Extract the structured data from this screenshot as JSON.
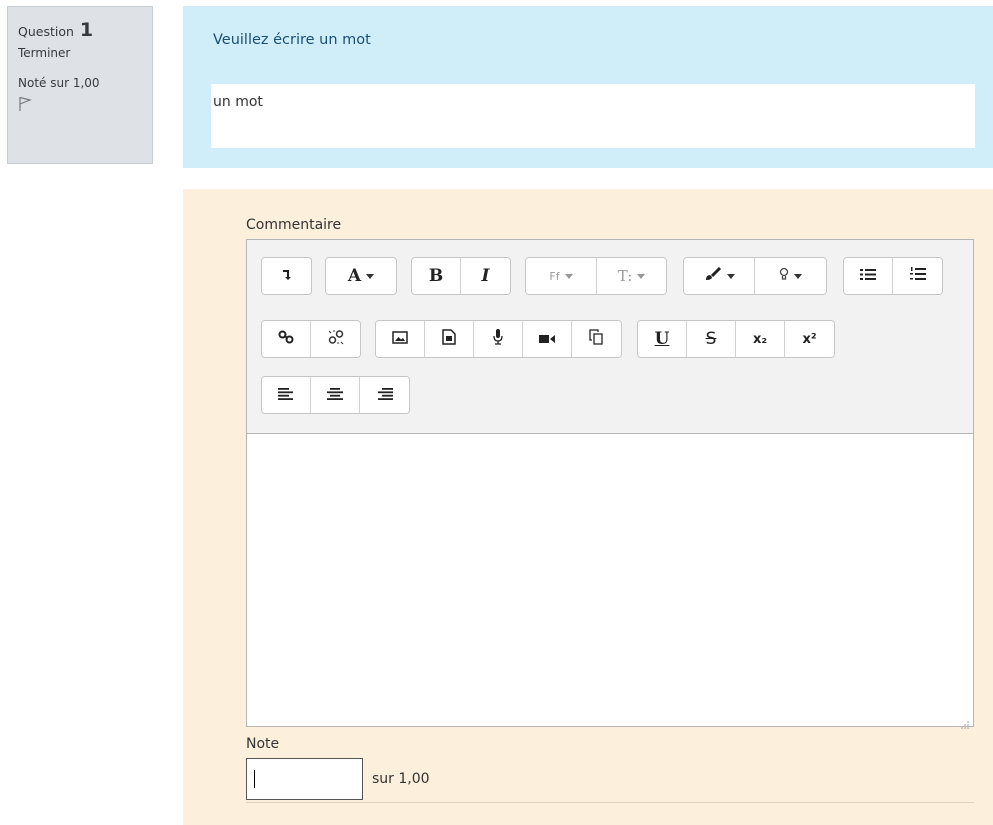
{
  "info": {
    "question_word": "Question",
    "question_number": "1",
    "state": "Terminer",
    "grade": "Noté sur 1,00",
    "flag_icon": "flag-icon"
  },
  "question": {
    "text": "Veuillez écrire un mot",
    "answer": "un mot"
  },
  "comment": {
    "label": "Commentaire",
    "toolbar": {
      "row1": [
        {
          "name": "toggle-toolbar",
          "icon": "arrow-down-icon"
        },
        {
          "name": "font-style",
          "label": "A"
        },
        {
          "name": "bold",
          "label": "B"
        },
        {
          "name": "italic",
          "label": "I"
        },
        {
          "name": "font-family",
          "label": "Ff"
        },
        {
          "name": "font-size",
          "label": "T:"
        },
        {
          "name": "font-color",
          "icon": "brush-icon"
        },
        {
          "name": "background-color",
          "icon": "bulb-icon"
        },
        {
          "name": "unordered-list",
          "icon": "list-icon"
        },
        {
          "name": "ordered-list",
          "icon": "ordered-list-icon"
        }
      ],
      "row2": [
        {
          "name": "link",
          "icon": "link-icon"
        },
        {
          "name": "unlink",
          "icon": "unlink-icon"
        },
        {
          "name": "image",
          "icon": "image-icon"
        },
        {
          "name": "media",
          "icon": "file-icon"
        },
        {
          "name": "record-audio",
          "icon": "microphone-icon"
        },
        {
          "name": "record-video",
          "icon": "video-camera-icon"
        },
        {
          "name": "manage-files",
          "icon": "files-icon"
        },
        {
          "name": "underline",
          "label": "U"
        },
        {
          "name": "strikethrough",
          "label": "S"
        },
        {
          "name": "subscript",
          "label": "x₂"
        },
        {
          "name": "superscript",
          "label": "x²"
        }
      ],
      "row3": [
        {
          "name": "align-left",
          "icon": "align-left-icon"
        },
        {
          "name": "align-center",
          "icon": "align-center-icon"
        },
        {
          "name": "align-right",
          "icon": "align-right-icon"
        }
      ]
    },
    "text": ""
  },
  "note": {
    "label": "Note",
    "value": "",
    "max": "sur 1,00"
  }
}
